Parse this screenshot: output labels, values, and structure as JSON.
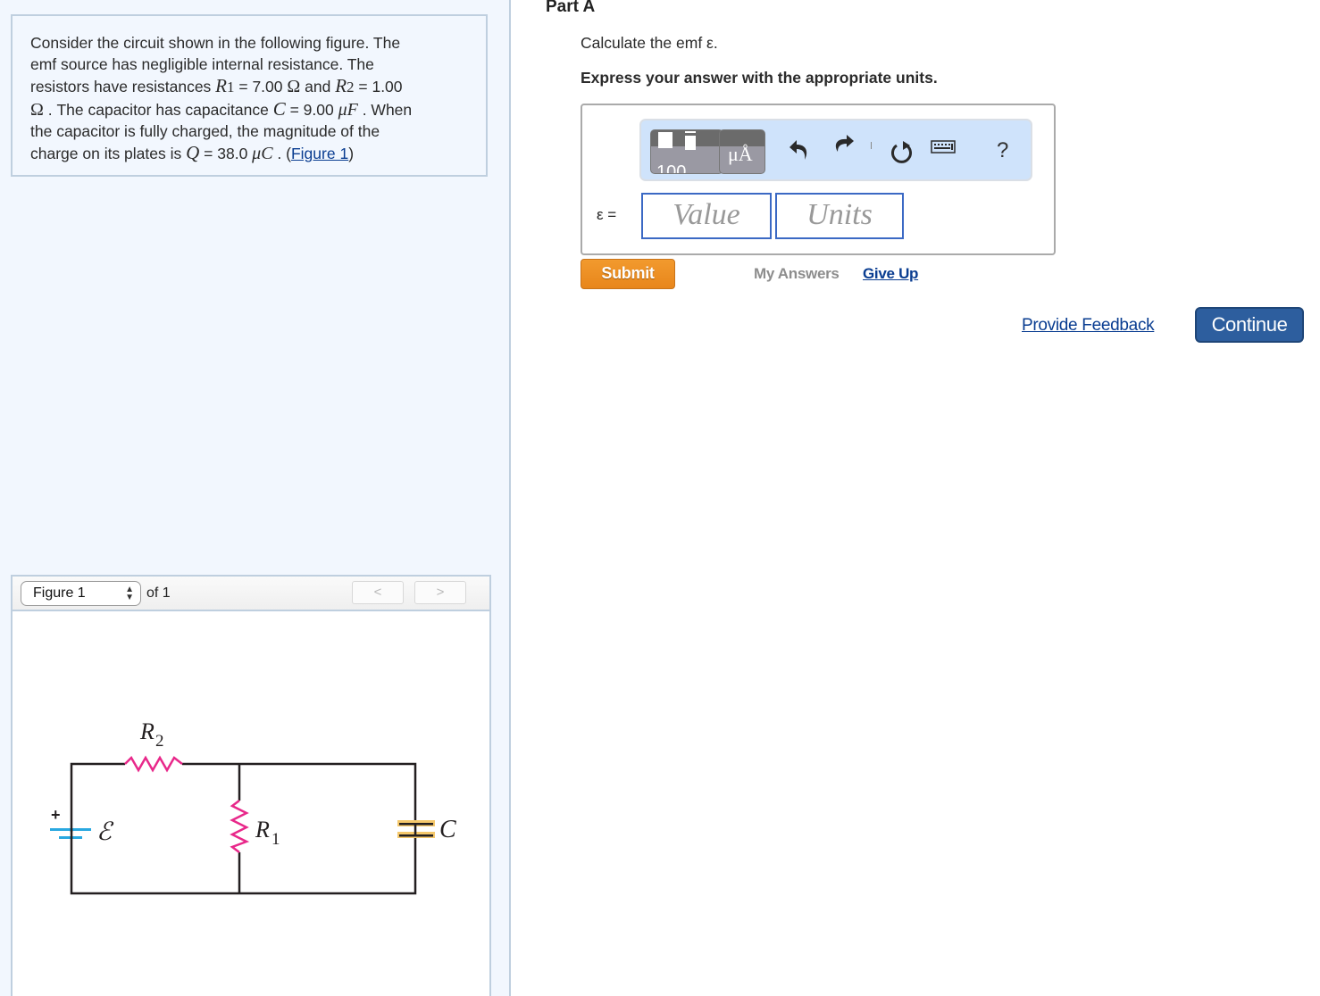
{
  "problem": {
    "lines": [
      [
        "Consider the circuit shown in the following figure. The"
      ],
      [
        "emf source has negligible internal resistance. The"
      ],
      [
        "resistors have resistances ",
        "R",
        "1",
        " = 7.00 ",
        "Ω",
        " and ",
        "R",
        "2",
        " = 1.00"
      ],
      [
        "Ω",
        " . The capacitor has capacitance ",
        "C",
        " = 9.00 ",
        "μF",
        " . When"
      ],
      [
        "the capacitor is fully charged, the magnitude of the"
      ],
      [
        "charge on its plates is ",
        "Q",
        " = 38.0 ",
        "μC",
        " . (",
        "Figure 1",
        ")"
      ]
    ],
    "given": {
      "R1": "7.00 Ω",
      "R2": "1.00 Ω",
      "C": "9.00 μF",
      "Q": "38.0 μC"
    },
    "figure_link": "Figure 1"
  },
  "figure_viewer": {
    "selected": "Figure 1",
    "of_label": "of 1",
    "prev_label": "<",
    "next_label": ">"
  },
  "circuit": {
    "labels": {
      "R2": "R",
      "R2_sub": "2",
      "R1": "R",
      "R1_sub": "1",
      "emf": "ℰ",
      "C": "C",
      "plus": "+"
    },
    "colors": {
      "wire": "#231f20",
      "resistor": "#e8288a",
      "battery": "#29a8e0",
      "capacitor": "#f5c86b"
    }
  },
  "part": {
    "title": "Part A",
    "prompt": "Calculate the emf ε.",
    "instruction": "Express your answer with the appropriate units."
  },
  "toolbar": {
    "template_icon": "templates-icon",
    "units_label": "μÅ",
    "undo_icon": "undo-icon",
    "redo_icon": "redo-icon",
    "reset_icon": "reset-icon",
    "keyboard_icon": "keyboard-icon",
    "help_label": "?"
  },
  "answer": {
    "variable_label": "ε =",
    "value_placeholder": "Value",
    "units_placeholder": "Units"
  },
  "actions": {
    "submit": "Submit",
    "my_answers": "My Answers",
    "give_up": "Give Up",
    "provide_feedback": "Provide Feedback",
    "continue": "Continue"
  },
  "colors": {
    "submit_bg": "#ef9226",
    "continue_bg": "#2d5e9e",
    "link": "#0a3d91",
    "input_border": "#3b69c4",
    "toolbar_bg": "#cfe3fb",
    "panel_bg": "#f2f7fe"
  }
}
